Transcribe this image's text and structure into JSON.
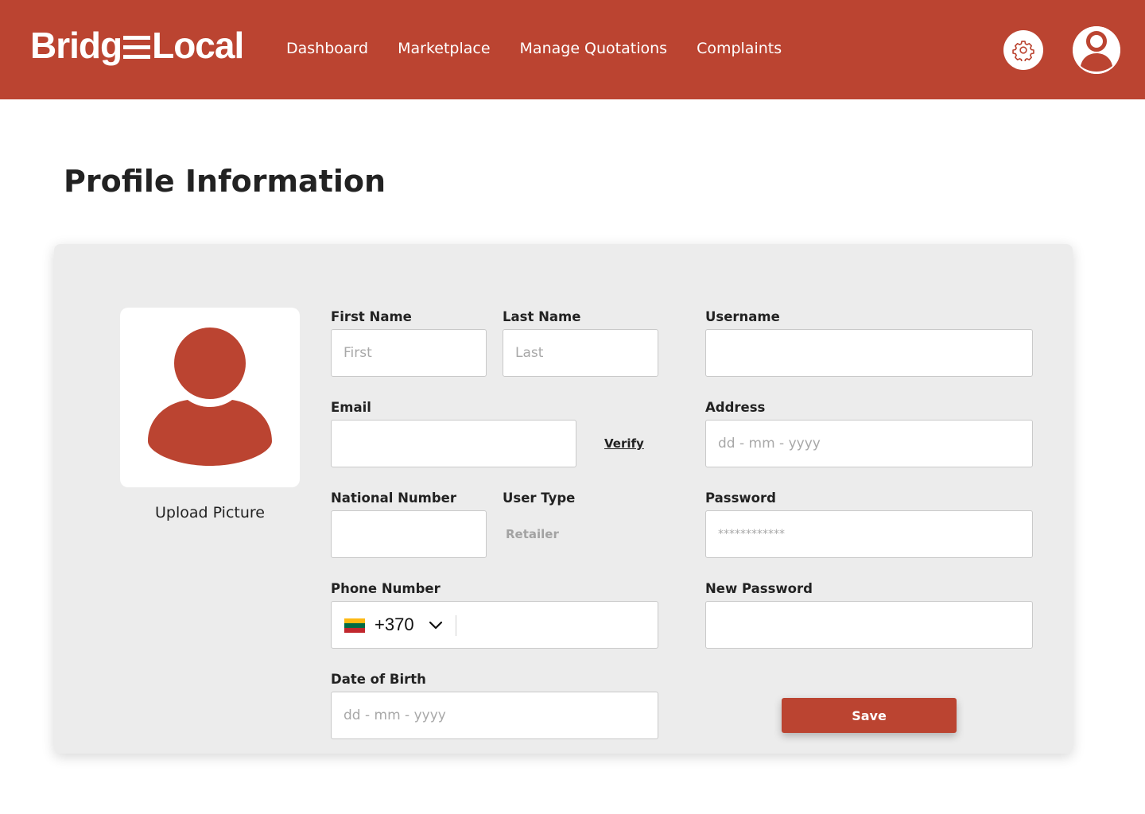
{
  "app": {
    "logo_left": "Bridg",
    "logo_right": "Local"
  },
  "nav": {
    "items": [
      {
        "label": "Dashboard"
      },
      {
        "label": "Marketplace"
      },
      {
        "label": "Manage Quotations"
      },
      {
        "label": "Complaints"
      }
    ]
  },
  "header_icons": {
    "settings": "gear-icon",
    "profile": "user-avatar-icon"
  },
  "page": {
    "title": "Profile Information"
  },
  "profile_picture": {
    "upload_label": "Upload Picture"
  },
  "form": {
    "first_name": {
      "label": "First Name",
      "value": "",
      "placeholder": "First"
    },
    "last_name": {
      "label": "Last Name",
      "value": "",
      "placeholder": "Last"
    },
    "username": {
      "label": "Username",
      "value": "",
      "placeholder": ""
    },
    "email": {
      "label": "Email",
      "value": "",
      "placeholder": ""
    },
    "verify_label": "Verify",
    "address": {
      "label": "Address",
      "value": "",
      "placeholder": "dd - mm - yyyy"
    },
    "national_number": {
      "label": "National Number",
      "value": "",
      "placeholder": ""
    },
    "user_type": {
      "label": "User Type",
      "value": "Retailer"
    },
    "password": {
      "label": "Password",
      "value": "",
      "placeholder": "************"
    },
    "phone_number": {
      "label": "Phone Number",
      "country_code": "+370",
      "country_flag": "lithuania-flag",
      "value": ""
    },
    "new_password": {
      "label": "New Password",
      "value": "",
      "placeholder": ""
    },
    "date_of_birth": {
      "label": "Date of Birth",
      "value": "",
      "placeholder": "dd - mm - yyyy"
    },
    "save_label": "Save"
  },
  "colors": {
    "brand": "#bb4431",
    "card_bg": "#ececec",
    "flag_yellow": "#fdb913",
    "flag_green": "#006a44",
    "flag_red": "#c1272d"
  }
}
